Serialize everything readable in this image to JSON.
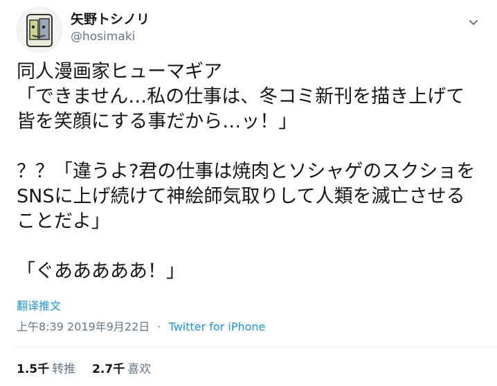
{
  "user": {
    "display_name": "矢野トシノリ",
    "handle": "@hosimaki"
  },
  "tweet": {
    "lines": [
      "同人漫画家ヒューマギア",
      "「できません…私の仕事は、冬コミ新刊を描き上げて",
      "皆を笑顔にする事だから…ッ！」",
      "",
      "？？「違うよ?君の仕事は焼肉とソシャゲのスクショを",
      "SNSに上げ続けて神絵師気取りして人類を滅亡させる",
      "ことだよ」",
      "",
      "「ぐあああああ！」"
    ],
    "translate_label": "翻译推文",
    "time": "上午8:39",
    "date": "2019年9月22日",
    "separator": "·",
    "source": "Twitter for iPhone"
  },
  "stats": {
    "retweets_count": "1.5千",
    "retweets_label": "转推",
    "likes_count": "2.7千",
    "likes_label": "喜欢"
  },
  "icons": {
    "more": "chevron-down-icon",
    "avatar": "avatar"
  },
  "colors": {
    "link": "#1b95e0",
    "muted": "#657786",
    "text": "#14171a"
  }
}
